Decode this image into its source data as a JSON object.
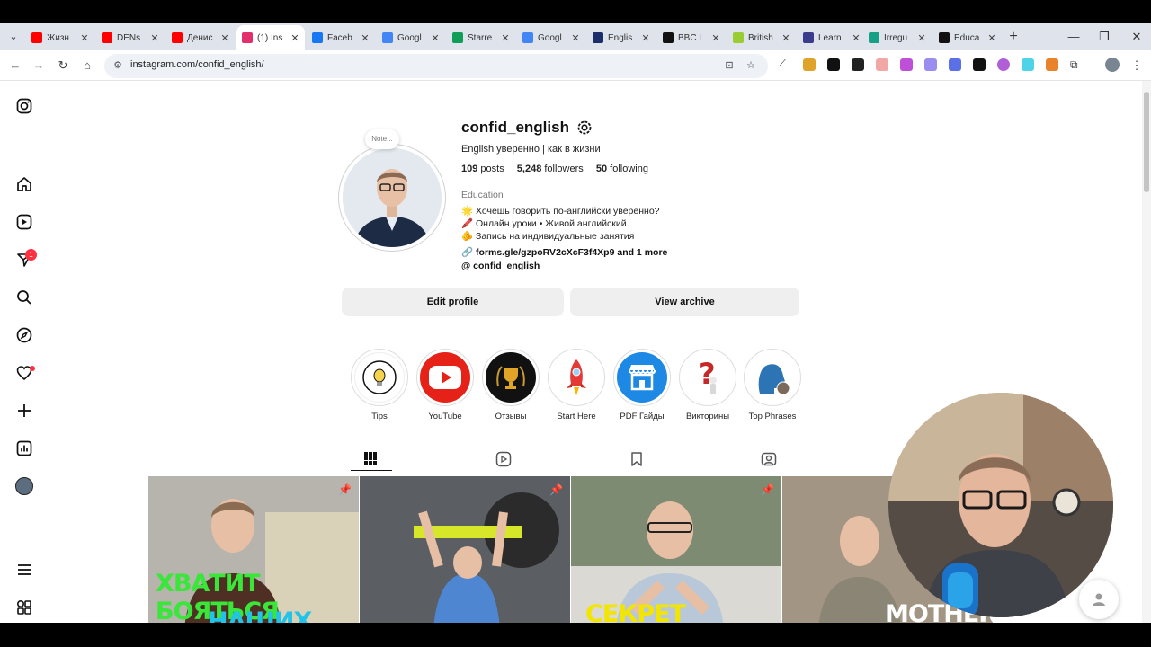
{
  "browser": {
    "tabs": [
      {
        "title": "Жизн",
        "favicon": "youtube-icon",
        "color": "#ff0000"
      },
      {
        "title": "DENs",
        "favicon": "youtube-icon",
        "color": "#ff0000"
      },
      {
        "title": "Денис",
        "favicon": "youtube-icon",
        "color": "#ff0000"
      },
      {
        "title": "(1) Ins",
        "favicon": "instagram-icon",
        "color": "#e1306c",
        "active": true
      },
      {
        "title": "Faceb",
        "favicon": "facebook-icon",
        "color": "#1877f2"
      },
      {
        "title": "Googl",
        "favicon": "google-translate-icon",
        "color": "#4285f4"
      },
      {
        "title": "Starre",
        "favicon": "google-drive-icon",
        "color": "#0f9d58"
      },
      {
        "title": "Googl",
        "favicon": "google-forms-icon",
        "color": "#4285f4"
      },
      {
        "title": "Englis",
        "favicon": "english-site-icon",
        "color": "#1c2f6b"
      },
      {
        "title": "BBC L",
        "favicon": "bbc-icon",
        "color": "#111111"
      },
      {
        "title": "British",
        "favicon": "british-council-icon",
        "color": "#9acd32"
      },
      {
        "title": "Learn",
        "favicon": "learn-site-icon",
        "color": "#3c3c8c"
      },
      {
        "title": "Irregu",
        "favicon": "irregular-verbs-icon",
        "color": "#17a085"
      },
      {
        "title": "Educa",
        "favicon": "education-site-icon",
        "color": "#111111"
      }
    ],
    "url": "instagram.com/confid_english/"
  },
  "profile": {
    "username": "confid_english",
    "tagline": "English уверенно | как в жизни",
    "note_placeholder": "Note...",
    "posts_count": "109",
    "posts_label": "posts",
    "followers_count": "5,248",
    "followers_label": "followers",
    "following_count": "50",
    "following_label": "following",
    "category": "Education",
    "bio": [
      "🌟 Хочешь говорить по-английски уверенно?",
      "🖍️ Онлайн уроки • Живой английский",
      "🫵 Запись на индивидуальные занятия"
    ],
    "link": "forms.gle/gzpoRV2cXcF3f4Xp9 and 1 more",
    "threads_handle": "confid_english",
    "edit_profile_label": "Edit profile",
    "view_archive_label": "View archive"
  },
  "highlights": [
    {
      "label": "Tips",
      "icon": "top-tips-bulb-icon"
    },
    {
      "label": "YouTube",
      "icon": "youtube-play-icon"
    },
    {
      "label": "Отзывы",
      "icon": "trophy-icon"
    },
    {
      "label": "Start Here",
      "icon": "rocket-icon"
    },
    {
      "label": "PDF Гайды",
      "icon": "shop-icon"
    },
    {
      "label": "Викторины",
      "icon": "question-mark-icon"
    },
    {
      "label": "Top Phrases",
      "icon": "speaking-head-icon"
    }
  ],
  "posts": [
    {
      "caption_line1": "ХВАТИТ БОЯТЬСЯ",
      "caption_line2": "НАШИХ",
      "caption_color": "#39e639",
      "pinned": true
    },
    {
      "caption_line1": "",
      "caption_line2": "",
      "caption_color": "#ffffff",
      "pinned": true
    },
    {
      "caption_line1": "СЕКРЕТ",
      "caption_line2": "",
      "caption_color": "#f2e600",
      "pinned": true
    },
    {
      "caption_line1": "MOTHER",
      "caption_line2": "",
      "caption_color": "#ffffff",
      "pinned": false
    }
  ],
  "notifications_badge": "1",
  "colors": {
    "button_bg": "#efefef",
    "youtube_red": "#ff0000",
    "instagram_pink": "#e1306c"
  }
}
